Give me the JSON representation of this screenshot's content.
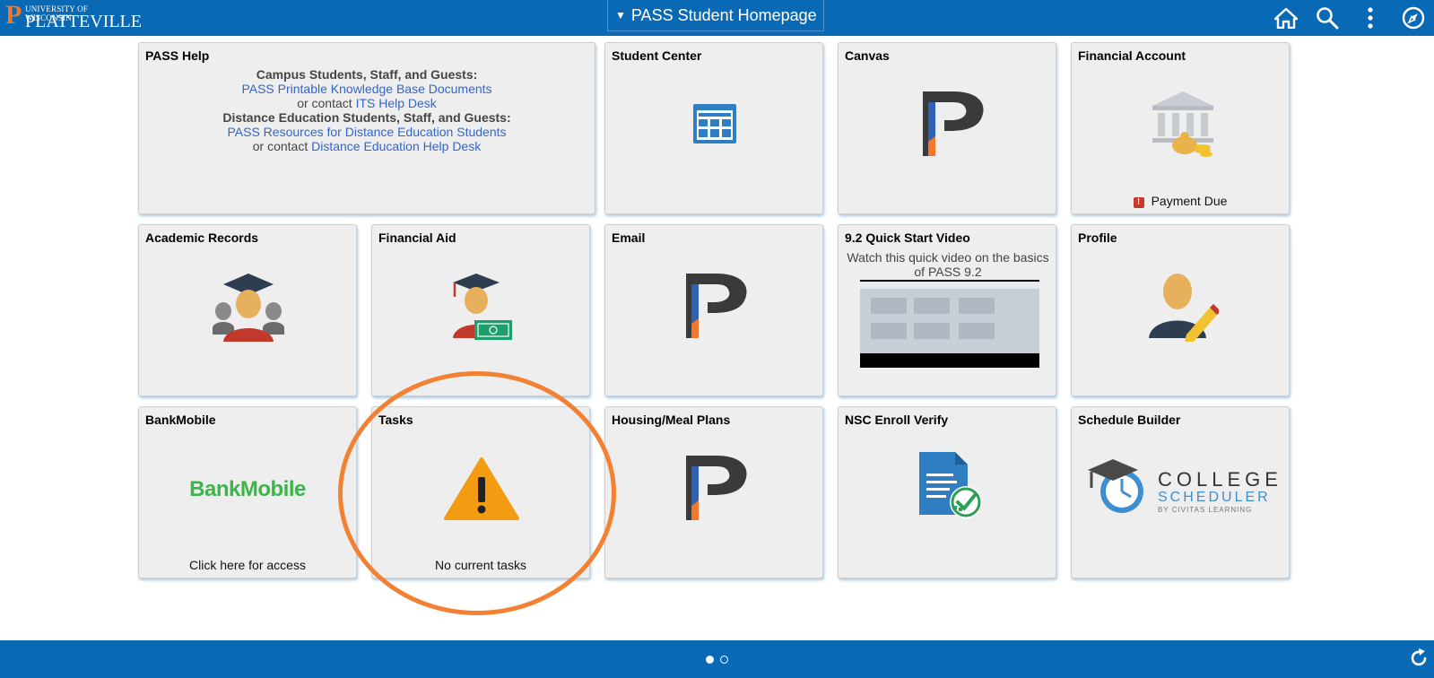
{
  "header": {
    "logo_top": "UNIVERSITY OF WISCONSIN",
    "logo_bottom": "PLATTEVILLE",
    "homepage_title": "PASS Student Homepage",
    "icons": [
      "home-icon",
      "search-icon",
      "more-vertical-icon",
      "navigation-compass-icon"
    ]
  },
  "tiles": {
    "pass_help": {
      "title": "PASS Help",
      "line1": "Campus Students, Staff, and Guests:",
      "link1": "PASS Printable Knowledge Base Documents",
      "line2_prefix": "or contact ",
      "link2": "ITS Help Desk",
      "line3": "Distance Education Students, Staff, and Guests:",
      "link3": "PASS Resources for Distance Education Students",
      "line4_prefix": "or contact ",
      "link4": "Distance Education Help Desk"
    },
    "student_center": {
      "title": "Student Center"
    },
    "canvas": {
      "title": "Canvas"
    },
    "financial_account": {
      "title": "Financial Account",
      "status": "Payment Due"
    },
    "academic_records": {
      "title": "Academic Records"
    },
    "financial_aid": {
      "title": "Financial Aid"
    },
    "email": {
      "title": "Email"
    },
    "quick_start": {
      "title": "9.2 Quick Start Video",
      "desc": "Watch this quick video on the basics of PASS 9.2"
    },
    "profile": {
      "title": "Profile"
    },
    "bankmobile": {
      "title": "BankMobile",
      "logo_text": "BankMobile",
      "footer": "Click here for access"
    },
    "tasks": {
      "title": "Tasks",
      "footer": "No current tasks"
    },
    "housing": {
      "title": "Housing/Meal Plans"
    },
    "nsc": {
      "title": "NSC Enroll Verify"
    },
    "schedule_builder": {
      "title": "Schedule Builder",
      "logo_line1": "COLLEGE",
      "logo_line2": "SCHEDULER",
      "logo_line3": "BY CIVITAS LEARNING"
    }
  },
  "colors": {
    "header_blue": "#0a69b4",
    "accent_orange": "#f0772b",
    "link_blue": "#3366cc"
  }
}
